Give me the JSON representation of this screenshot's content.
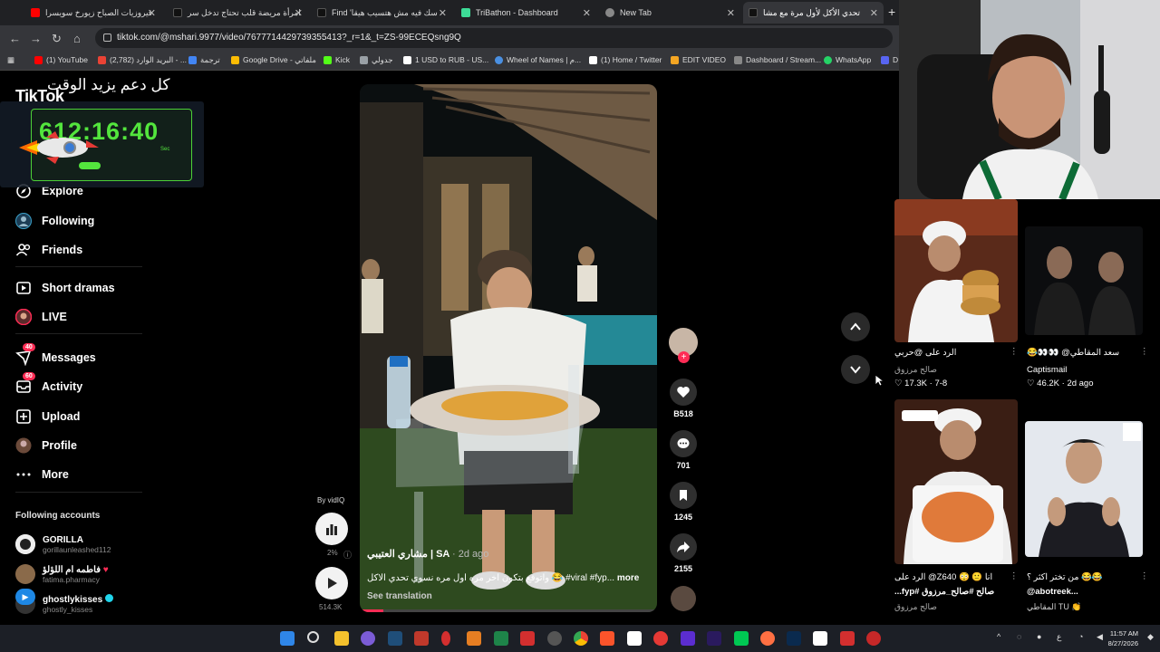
{
  "browser": {
    "tabs": [
      {
        "label": "فيروزيات الصباح زيورخ سويسرا"
      },
      {
        "label": "امرأة مريضة قلب تحتاج تدخل سر"
      },
      {
        "label": "Find 'سك فيه مش هتسيب هيقا"
      },
      {
        "label": "TriBathon - Dashboard"
      },
      {
        "label": "New Tab"
      },
      {
        "label": "تحدي الأكل لأول مرة مع مشا"
      }
    ],
    "url": "tiktok.com/@mshari.9977/video/7677714429739355413?_r=1&_t=ZS-99ECEQsng9Q",
    "bookmarks": [
      {
        "label": "(1) YouTube",
        "color": "#ff0000"
      },
      {
        "label": "(2,782) البريد الوارد - ...",
        "color": "#ea4335"
      },
      {
        "label": "ترجمة",
        "color": "#4285f4"
      },
      {
        "label": "Google Drive - ملفاتي",
        "color": "#fbbc04"
      },
      {
        "label": "Kick",
        "color": "#53fc18"
      },
      {
        "label": "جدولي",
        "color": "#9aa0a6"
      },
      {
        "label": "1 USD to RUB - US...",
        "color": "#ffffff"
      },
      {
        "label": "Wheel of Names | م...",
        "color": "#4a90e2"
      },
      {
        "label": "(1) Home / Twitter",
        "color": "#ffffff"
      },
      {
        "label": "EDIT VIDEO",
        "color": "#f5a623"
      },
      {
        "label": "Dashboard / Stream...",
        "color": "#888888"
      },
      {
        "label": "WhatsApp",
        "color": "#25d366"
      },
      {
        "label": "D",
        "color": "#5865f2"
      }
    ]
  },
  "overlay": {
    "title": "كل دعم يزيد الوقت",
    "timer": "612:16:40",
    "sec_label": "Sec"
  },
  "sidebar": {
    "logo": "TikTok",
    "nav": [
      {
        "label": "Explore",
        "icon": "compass-icon"
      },
      {
        "label": "Following",
        "icon": "following-avatar-icon"
      },
      {
        "label": "Friends",
        "icon": "friends-icon"
      },
      {
        "label": "Short dramas",
        "icon": "film-icon"
      },
      {
        "label": "LIVE",
        "icon": "live-avatar-icon"
      },
      {
        "label": "Messages",
        "icon": "message-icon",
        "badge": "40"
      },
      {
        "label": "Activity",
        "icon": "inbox-icon",
        "badge": "60"
      },
      {
        "label": "Upload",
        "icon": "plus-square-icon"
      },
      {
        "label": "Profile",
        "icon": "profile-avatar-icon"
      },
      {
        "label": "More",
        "icon": "more-icon"
      }
    ],
    "following_header": "Following accounts",
    "following": [
      {
        "name": "GORILLA",
        "handle": "gorillaunleashed112"
      },
      {
        "name": "فاطمه ام اللؤلؤ",
        "handle": "fatima.pharmacy"
      },
      {
        "name": "ghostlykisses",
        "handle": "ghostly_kisses"
      }
    ]
  },
  "video": {
    "author": "مشاري العتيبي | SA",
    "time": "· 2d ago",
    "description": "واتوقع بتكون اخر مره اول مره نسوي تحدي الاكل 😂 #viral #fyp...",
    "more": "more",
    "see_translation": "See translation",
    "by": "By vidIQ",
    "pct": "2%",
    "views": "514.3K"
  },
  "actions": {
    "likes": "B518",
    "comments": "701",
    "saves": "1245",
    "shares": "2155"
  },
  "recommendations": [
    {
      "title": "الرد على @حربي",
      "author": "صالح مرزوق",
      "likes": "17.3K",
      "date": "7-8"
    },
    {
      "title": "سعد المقاطي@ 👀👀😂",
      "author": "Captismail",
      "likes": "46.2K",
      "date": "2d ago"
    },
    {
      "title": "انا 🙂 😳 Z640@ الرد على",
      "subtitle": "صالح #صالح_مرزوق #fyp...",
      "author": "صالح مرزوق"
    },
    {
      "title": "😂😂 من تختر اكثر ؟",
      "subtitle": "@abotreek...",
      "author": "المقاطي TU 👏"
    }
  ],
  "taskbar": {
    "time": "11:57 AM",
    "date": "8/27/2026"
  }
}
